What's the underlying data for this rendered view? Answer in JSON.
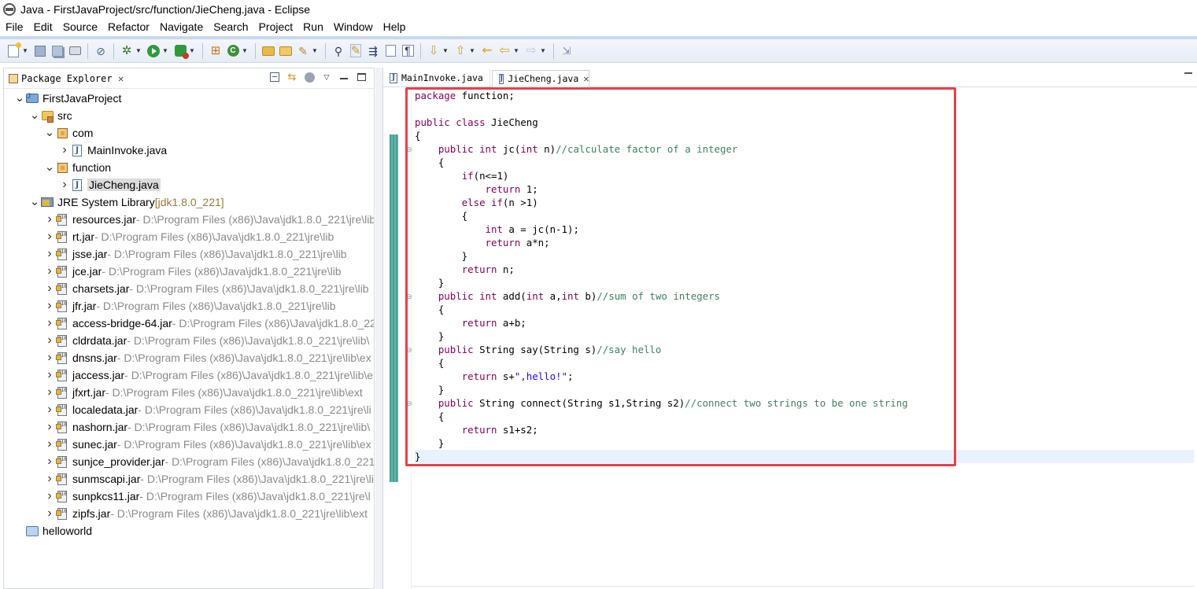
{
  "window": {
    "title": "Java - FirstJavaProject/src/function/JieCheng.java - Eclipse"
  },
  "menu": [
    "File",
    "Edit",
    "Source",
    "Refactor",
    "Navigate",
    "Search",
    "Project",
    "Run",
    "Window",
    "Help"
  ],
  "toolbar": {
    "icons": [
      "new-icon",
      "save-icon",
      "save-all-icon",
      "print-icon",
      "skip-breakpoints-icon",
      "debug-icon",
      "run-icon",
      "external-tools-icon",
      "new-package-icon",
      "new-class-icon",
      "open-folder-icon",
      "open-type-icon",
      "open-task-icon",
      "search-icon",
      "toggle-mark-occurrences-icon",
      "toggle-block-selection-icon",
      "show-whitespace-icon",
      "next-annotation-icon",
      "previous-annotation-icon",
      "back-icon",
      "forward-icon",
      "pin-editor-icon"
    ]
  },
  "package_explorer": {
    "tab_label": "Package Explorer",
    "tree": [
      {
        "depth": 0,
        "twisty": "expanded",
        "icon": "project",
        "label": "FirstJavaProject",
        "deco": ""
      },
      {
        "depth": 1,
        "twisty": "expanded",
        "icon": "src",
        "label": "src",
        "deco": ""
      },
      {
        "depth": 2,
        "twisty": "expanded",
        "icon": "package",
        "label": "com",
        "deco": ""
      },
      {
        "depth": 3,
        "twisty": "collapsed",
        "icon": "java",
        "label": "MainInvoke.java",
        "deco": ""
      },
      {
        "depth": 2,
        "twisty": "expanded",
        "icon": "package",
        "label": "function",
        "deco": ""
      },
      {
        "depth": 3,
        "twisty": "collapsed",
        "icon": "java",
        "label": "JieCheng.java",
        "deco": "",
        "selected": true
      },
      {
        "depth": 1,
        "twisty": "expanded",
        "icon": "library",
        "label": "JRE System Library",
        "deco": "[jdk1.8.0_221]",
        "deco_style": "jre"
      },
      {
        "depth": 2,
        "twisty": "collapsed",
        "icon": "jar",
        "label": "resources.jar",
        "deco": "- D:\\Program Files (x86)\\Java\\jdk1.8.0_221\\jre\\lib"
      },
      {
        "depth": 2,
        "twisty": "collapsed",
        "icon": "jar",
        "label": "rt.jar",
        "deco": "- D:\\Program Files (x86)\\Java\\jdk1.8.0_221\\jre\\lib"
      },
      {
        "depth": 2,
        "twisty": "collapsed",
        "icon": "jar",
        "label": "jsse.jar",
        "deco": "- D:\\Program Files (x86)\\Java\\jdk1.8.0_221\\jre\\lib"
      },
      {
        "depth": 2,
        "twisty": "collapsed",
        "icon": "jar",
        "label": "jce.jar",
        "deco": "- D:\\Program Files (x86)\\Java\\jdk1.8.0_221\\jre\\lib"
      },
      {
        "depth": 2,
        "twisty": "collapsed",
        "icon": "jar",
        "label": "charsets.jar",
        "deco": "- D:\\Program Files (x86)\\Java\\jdk1.8.0_221\\jre\\lib"
      },
      {
        "depth": 2,
        "twisty": "collapsed",
        "icon": "jar",
        "label": "jfr.jar",
        "deco": "- D:\\Program Files (x86)\\Java\\jdk1.8.0_221\\jre\\lib"
      },
      {
        "depth": 2,
        "twisty": "collapsed",
        "icon": "jar",
        "label": "access-bridge-64.jar",
        "deco": "- D:\\Program Files (x86)\\Java\\jdk1.8.0_22"
      },
      {
        "depth": 2,
        "twisty": "collapsed",
        "icon": "jar",
        "label": "cldrdata.jar",
        "deco": "- D:\\Program Files (x86)\\Java\\jdk1.8.0_221\\jre\\lib\\"
      },
      {
        "depth": 2,
        "twisty": "collapsed",
        "icon": "jar",
        "label": "dnsns.jar",
        "deco": "- D:\\Program Files (x86)\\Java\\jdk1.8.0_221\\jre\\lib\\ex"
      },
      {
        "depth": 2,
        "twisty": "collapsed",
        "icon": "jar",
        "label": "jaccess.jar",
        "deco": "- D:\\Program Files (x86)\\Java\\jdk1.8.0_221\\jre\\lib\\e"
      },
      {
        "depth": 2,
        "twisty": "collapsed",
        "icon": "jar",
        "label": "jfxrt.jar",
        "deco": "- D:\\Program Files (x86)\\Java\\jdk1.8.0_221\\jre\\lib\\ext"
      },
      {
        "depth": 2,
        "twisty": "collapsed",
        "icon": "jar",
        "label": "localedata.jar",
        "deco": "- D:\\Program Files (x86)\\Java\\jdk1.8.0_221\\jre\\li"
      },
      {
        "depth": 2,
        "twisty": "collapsed",
        "icon": "jar",
        "label": "nashorn.jar",
        "deco": "- D:\\Program Files (x86)\\Java\\jdk1.8.0_221\\jre\\lib\\"
      },
      {
        "depth": 2,
        "twisty": "collapsed",
        "icon": "jar",
        "label": "sunec.jar",
        "deco": "- D:\\Program Files (x86)\\Java\\jdk1.8.0_221\\jre\\lib\\ex"
      },
      {
        "depth": 2,
        "twisty": "collapsed",
        "icon": "jar",
        "label": "sunjce_provider.jar",
        "deco": "- D:\\Program Files (x86)\\Java\\jdk1.8.0_221"
      },
      {
        "depth": 2,
        "twisty": "collapsed",
        "icon": "jar",
        "label": "sunmscapi.jar",
        "deco": "- D:\\Program Files (x86)\\Java\\jdk1.8.0_221\\jre\\li"
      },
      {
        "depth": 2,
        "twisty": "collapsed",
        "icon": "jar",
        "label": "sunpkcs11.jar",
        "deco": "- D:\\Program Files (x86)\\Java\\jdk1.8.0_221\\jre\\l"
      },
      {
        "depth": 2,
        "twisty": "collapsed",
        "icon": "jar",
        "label": "zipfs.jar",
        "deco": "- D:\\Program Files (x86)\\Java\\jdk1.8.0_221\\jre\\lib\\ext"
      },
      {
        "depth": 0,
        "twisty": "none",
        "icon": "project-closed",
        "label": "helloworld",
        "deco": ""
      }
    ]
  },
  "editor": {
    "tabs": [
      {
        "label": "MainInvoke.java",
        "active": false
      },
      {
        "label": "JieCheng.java",
        "active": true
      }
    ],
    "fold_markers": [
      4,
      15,
      19,
      23
    ],
    "current_line": 28,
    "lines": [
      [
        [
          "kw",
          "package"
        ],
        [
          "t",
          " function;"
        ]
      ],
      [],
      [
        [
          "kw",
          "public"
        ],
        [
          "t",
          " "
        ],
        [
          "kw",
          "class"
        ],
        [
          "t",
          " JieCheng"
        ]
      ],
      [
        [
          "t",
          "{"
        ]
      ],
      [
        [
          "t",
          "    "
        ],
        [
          "kw",
          "public"
        ],
        [
          "t",
          " "
        ],
        [
          "kw",
          "int"
        ],
        [
          "t",
          " jc("
        ],
        [
          "kw",
          "int"
        ],
        [
          "t",
          " n)"
        ],
        [
          "cm",
          "//calculate factor of a integer"
        ]
      ],
      [
        [
          "t",
          "    {"
        ]
      ],
      [
        [
          "t",
          "        "
        ],
        [
          "kw",
          "if"
        ],
        [
          "t",
          "(n<=1)"
        ]
      ],
      [
        [
          "t",
          "            "
        ],
        [
          "kw",
          "return"
        ],
        [
          "t",
          " 1;"
        ]
      ],
      [
        [
          "t",
          "        "
        ],
        [
          "kw",
          "else"
        ],
        [
          "t",
          " "
        ],
        [
          "kw",
          "if"
        ],
        [
          "t",
          "(n >1)"
        ]
      ],
      [
        [
          "t",
          "        {"
        ]
      ],
      [
        [
          "t",
          "            "
        ],
        [
          "kw",
          "int"
        ],
        [
          "t",
          " a = jc(n-1);"
        ]
      ],
      [
        [
          "t",
          "            "
        ],
        [
          "kw",
          "return"
        ],
        [
          "t",
          " a*n;"
        ]
      ],
      [
        [
          "t",
          "        }"
        ]
      ],
      [
        [
          "t",
          "        "
        ],
        [
          "kw",
          "return"
        ],
        [
          "t",
          " n;"
        ]
      ],
      [
        [
          "t",
          "    }"
        ]
      ],
      [
        [
          "t",
          "    "
        ],
        [
          "kw",
          "public"
        ],
        [
          "t",
          " "
        ],
        [
          "kw",
          "int"
        ],
        [
          "t",
          " add("
        ],
        [
          "kw",
          "int"
        ],
        [
          "t",
          " a,"
        ],
        [
          "kw",
          "int"
        ],
        [
          "t",
          " b)"
        ],
        [
          "cm",
          "//sum of two integers"
        ]
      ],
      [
        [
          "t",
          "    {"
        ]
      ],
      [
        [
          "t",
          "        "
        ],
        [
          "kw",
          "return"
        ],
        [
          "t",
          " a+b;"
        ]
      ],
      [
        [
          "t",
          "    }"
        ]
      ],
      [
        [
          "t",
          "    "
        ],
        [
          "kw",
          "public"
        ],
        [
          "t",
          " String say(String s)"
        ],
        [
          "cm",
          "//say hello"
        ]
      ],
      [
        [
          "t",
          "    {"
        ]
      ],
      [
        [
          "t",
          "        "
        ],
        [
          "kw",
          "return"
        ],
        [
          "t",
          " s+"
        ],
        [
          "st",
          "\",hello!\""
        ],
        [
          "t",
          ";"
        ]
      ],
      [
        [
          "t",
          "    }"
        ]
      ],
      [
        [
          "t",
          "    "
        ],
        [
          "kw",
          "public"
        ],
        [
          "t",
          " String connect(String s1,String s2)"
        ],
        [
          "cm",
          "//connect two strings to be one string"
        ]
      ],
      [
        [
          "t",
          "    {"
        ]
      ],
      [
        [
          "t",
          "        "
        ],
        [
          "kw",
          "return"
        ],
        [
          "t",
          " s1+s2;"
        ]
      ],
      [
        [
          "t",
          "    }"
        ]
      ],
      [
        [
          "t",
          "}"
        ]
      ]
    ]
  },
  "colors": {
    "keyword": "#7f0055",
    "comment": "#3f7f5f",
    "string": "#2a00ff",
    "annotation_box": "#e5414a",
    "toolbar_bg": "#e6ecf5"
  }
}
